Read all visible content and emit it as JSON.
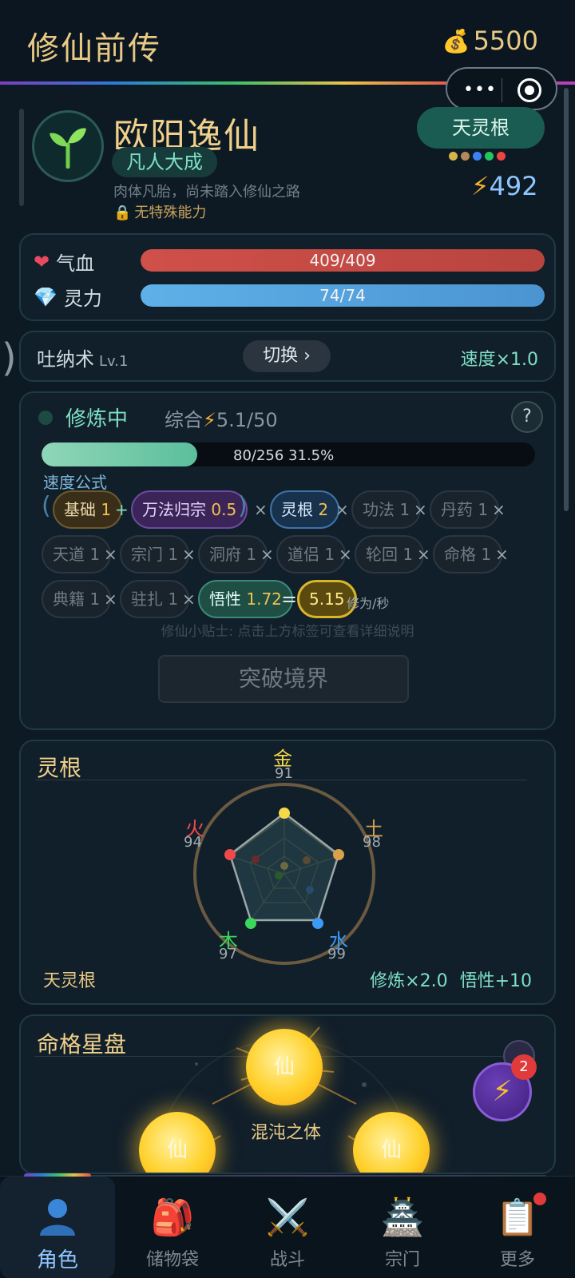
{
  "header": {
    "title": "修仙前传",
    "coins": "5500"
  },
  "player": {
    "name": "欧阳逸仙",
    "realm": "凡人大成",
    "description": "肉体凡胎，尚未踏入修仙之路",
    "ability": "无特殊能力",
    "spirit_root": "天灵根",
    "power": "492",
    "element_colors": [
      "#d8b24a",
      "#b48a5a",
      "#3b82f6",
      "#22c55e",
      "#ef4444"
    ]
  },
  "stats": {
    "hp_label": "气血",
    "hp_value": "409/409",
    "hp_fraction": 1.0,
    "mp_label": "灵力",
    "mp_value": "74/74",
    "mp_fraction": 1.0
  },
  "technique": {
    "name": "吐纳术",
    "level": "Lv.1",
    "switch_label": "切换 ›",
    "speed": "速度×1.0"
  },
  "cultivation": {
    "status": "修炼中",
    "overall_prefix": "综合",
    "overall_value": "5.1/50",
    "help": "?",
    "progress_text": "80/256  31.5%",
    "progress_fraction": 0.315,
    "formula_label": "速度公式",
    "factors": {
      "base": {
        "name": "基础",
        "mult": "1"
      },
      "method": {
        "name": "万法归宗",
        "mult": "0.5"
      },
      "root": {
        "name": "灵根",
        "mult": "2"
      },
      "gongfa": {
        "name": "功法",
        "mult": "1"
      },
      "pill": {
        "name": "丹药",
        "mult": "1"
      },
      "heaven": {
        "name": "天道",
        "mult": "1"
      },
      "sect": {
        "name": "宗门",
        "mult": "1"
      },
      "cave": {
        "name": "洞府",
        "mult": "1"
      },
      "partner": {
        "name": "道侣",
        "mult": "1"
      },
      "rebirth": {
        "name": "轮回",
        "mult": "1"
      },
      "fate": {
        "name": "命格",
        "mult": "1"
      },
      "book": {
        "name": "典籍",
        "mult": "1"
      },
      "station": {
        "name": "驻扎",
        "mult": "1"
      },
      "wisdom": {
        "name": "悟性",
        "mult": "1.72"
      }
    },
    "result": "5.15",
    "result_unit": "修为/秒",
    "tip": "修仙小贴士: 点击上方标签可查看详细说明",
    "breakthrough_label": "突破境界"
  },
  "spirit_root_section": {
    "title": "灵根",
    "elements": {
      "metal": {
        "name": "金",
        "value": "91",
        "color": "#f5d94a"
      },
      "earth": {
        "name": "土",
        "value": "98",
        "color": "#d9a24a"
      },
      "water": {
        "name": "水",
        "value": "99",
        "color": "#3b9bf5"
      },
      "wood": {
        "name": "木",
        "value": "97",
        "color": "#3bd65a"
      },
      "fire": {
        "name": "火",
        "value": "94",
        "color": "#ef4a4a"
      }
    },
    "root_name": "天灵根",
    "bonus": "修炼×2.0 悟性+10"
  },
  "fate_section": {
    "title": "命格星盘",
    "star_label": "仙",
    "center_name": "混沌之体",
    "fab_badge": "2"
  },
  "nav": {
    "items": [
      {
        "label": "角色",
        "icon": "character-icon"
      },
      {
        "label": "储物袋",
        "icon": "backpack-icon"
      },
      {
        "label": "战斗",
        "icon": "swords-icon"
      },
      {
        "label": "宗门",
        "icon": "pagoda-icon"
      },
      {
        "label": "更多",
        "icon": "clipboard-icon"
      }
    ]
  }
}
